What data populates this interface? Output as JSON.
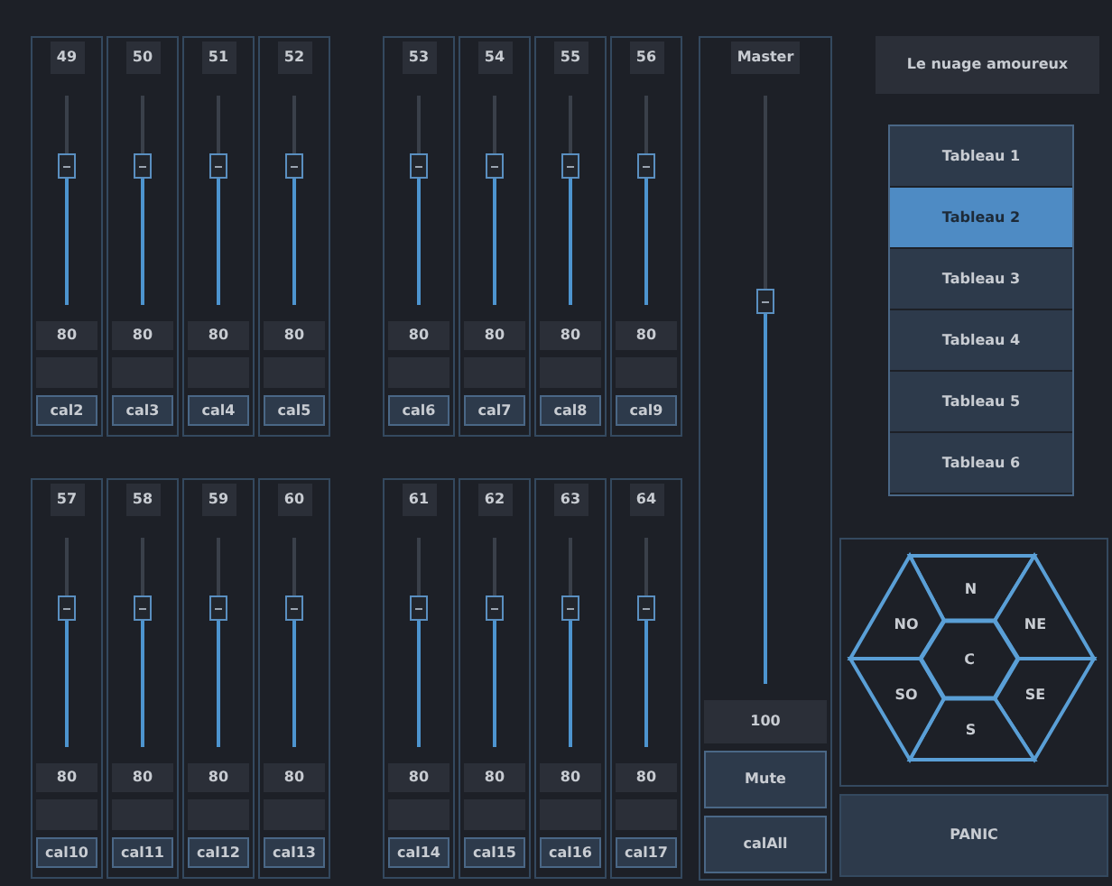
{
  "fader_rows": [
    {
      "groups": [
        {
          "strips": [
            {
              "number": "49",
              "level": 0.66,
              "value": "80",
              "button": "cal2"
            },
            {
              "number": "50",
              "level": 0.66,
              "value": "80",
              "button": "cal3"
            },
            {
              "number": "51",
              "level": 0.66,
              "value": "80",
              "button": "cal4"
            },
            {
              "number": "52",
              "level": 0.66,
              "value": "80",
              "button": "cal5"
            }
          ]
        },
        {
          "strips": [
            {
              "number": "53",
              "level": 0.66,
              "value": "80",
              "button": "cal6"
            },
            {
              "number": "54",
              "level": 0.66,
              "value": "80",
              "button": "cal7"
            },
            {
              "number": "55",
              "level": 0.66,
              "value": "80",
              "button": "cal8"
            },
            {
              "number": "56",
              "level": 0.66,
              "value": "80",
              "button": "cal9"
            }
          ]
        }
      ]
    },
    {
      "groups": [
        {
          "strips": [
            {
              "number": "57",
              "level": 0.66,
              "value": "80",
              "button": "cal10"
            },
            {
              "number": "58",
              "level": 0.66,
              "value": "80",
              "button": "cal11"
            },
            {
              "number": "59",
              "level": 0.66,
              "value": "80",
              "button": "cal12"
            },
            {
              "number": "60",
              "level": 0.66,
              "value": "80",
              "button": "cal13"
            }
          ]
        },
        {
          "strips": [
            {
              "number": "61",
              "level": 0.66,
              "value": "80",
              "button": "cal14"
            },
            {
              "number": "62",
              "level": 0.66,
              "value": "80",
              "button": "cal15"
            },
            {
              "number": "63",
              "level": 0.66,
              "value": "80",
              "button": "cal16"
            },
            {
              "number": "64",
              "level": 0.66,
              "value": "80",
              "button": "cal17"
            }
          ]
        }
      ]
    }
  ],
  "master": {
    "label": "Master",
    "level": 0.65,
    "value": "100",
    "buttons": [
      "Mute",
      "calAll"
    ]
  },
  "title": "Le nuage amoureux",
  "tableaux": [
    {
      "label": "Tableau 1",
      "selected": false
    },
    {
      "label": "Tableau 2",
      "selected": true
    },
    {
      "label": "Tableau 3",
      "selected": false
    },
    {
      "label": "Tableau 4",
      "selected": false
    },
    {
      "label": "Tableau 5",
      "selected": false
    },
    {
      "label": "Tableau 6",
      "selected": false
    }
  ],
  "pad": {
    "center": "C",
    "sectors": [
      "N",
      "NE",
      "SE",
      "S",
      "SO",
      "NO"
    ]
  },
  "panic": "PANIC"
}
